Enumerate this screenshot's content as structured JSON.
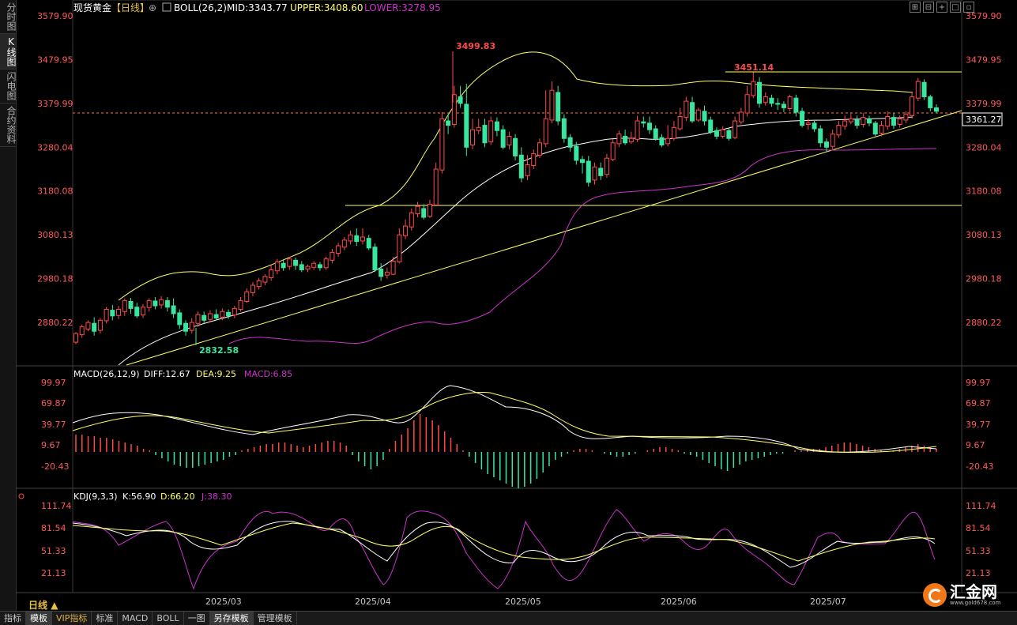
{
  "sidebar": [
    {
      "label": "分时图",
      "active": false
    },
    {
      "label": "K线图",
      "active": true
    },
    {
      "label": "闪电图",
      "active": false
    },
    {
      "label": "合约资料",
      "active": false
    }
  ],
  "header": {
    "symbol": "现货黄金",
    "period_tag": "【日线】",
    "boll_label": "BOLL(26,2)",
    "mid": "MID:3343.77",
    "upper": "UPPER:3408.60",
    "lower": "LOWER:3278.95"
  },
  "toolbar_icons": [
    "expand-icon",
    "shrink-icon",
    "crosshair-icon",
    "fullscreen-icon",
    "pin-icon"
  ],
  "price_panel": {
    "y_ticks": [
      "3579.90",
      "3479.95",
      "3379.99",
      "3280.04",
      "3180.08",
      "3080.13",
      "2980.18",
      "2880.22"
    ],
    "annotations": {
      "high": "3499.83",
      "high2": "3451.14",
      "low": "2832.58",
      "current": "3361.27"
    }
  },
  "macd_panel": {
    "title": "MACD(26,12,9)",
    "diff": "DIFF:12.67",
    "dea": "DEA:9.25",
    "macd": "MACD:6.85",
    "y_ticks": [
      "99.97",
      "69.87",
      "39.77",
      "9.67",
      "-20.43"
    ]
  },
  "kdj_panel": {
    "title": "KDJ(9,3,3)",
    "k": "K:56.90",
    "d": "D:66.20",
    "j": "J:38.30",
    "y_ticks": [
      "111.74",
      "81.54",
      "51.33",
      "21.13"
    ]
  },
  "x_axis": [
    "2025/03",
    "2025/04",
    "2025/05",
    "2025/06",
    "2025/07"
  ],
  "period_label": "日线",
  "bottom_tabs": [
    {
      "label": "指标",
      "sel": false
    },
    {
      "label": "模板",
      "sel": true
    },
    {
      "label": "VIP指标",
      "sel": false,
      "vip": true
    },
    {
      "label": "标准",
      "sel": false
    },
    {
      "label": "MACD",
      "sel": false
    },
    {
      "label": "BOLL",
      "sel": false
    },
    {
      "label": "一图",
      "sel": false
    },
    {
      "label": "另存模板",
      "sel": true
    },
    {
      "label": "管理模板",
      "sel": false
    }
  ],
  "logo": {
    "name": "汇金网",
    "url": "www.gold678.com"
  },
  "colors": {
    "up": "#ff4a4a",
    "down": "#39e6a0",
    "mid": "#ffffff",
    "upper": "#ffff66",
    "lower": "#cc33cc",
    "dea": "#ffff66",
    "diff": "#ffffff",
    "kdj_j": "#cc33cc"
  },
  "chart_data": {
    "type": "candlestick",
    "ylim": [
      2830,
      3590
    ],
    "y_scale_ref": {
      "price_a": 3579.9,
      "price_b": 2880.22
    },
    "candles": [
      [
        2835,
        2855,
        2830,
        2858
      ],
      [
        2852,
        2870,
        2845,
        2875
      ],
      [
        2865,
        2880,
        2860,
        2885
      ],
      [
        2878,
        2860,
        2850,
        2892
      ],
      [
        2862,
        2885,
        2855,
        2890
      ],
      [
        2884,
        2910,
        2878,
        2915
      ],
      [
        2908,
        2895,
        2885,
        2920
      ],
      [
        2896,
        2910,
        2888,
        2918
      ],
      [
        2905,
        2930,
        2895,
        2935
      ],
      [
        2928,
        2912,
        2900,
        2936
      ],
      [
        2915,
        2895,
        2890,
        2925
      ],
      [
        2897,
        2915,
        2890,
        2922
      ],
      [
        2914,
        2930,
        2905,
        2935
      ],
      [
        2929,
        2918,
        2910,
        2938
      ],
      [
        2920,
        2932,
        2912,
        2940
      ],
      [
        2930,
        2915,
        2905,
        2938
      ],
      [
        2918,
        2900,
        2890,
        2935
      ],
      [
        2902,
        2875,
        2865,
        2910
      ],
      [
        2878,
        2860,
        2850,
        2885
      ],
      [
        2862,
        2880,
        2855,
        2890
      ],
      [
        2878,
        2898,
        2870,
        2905
      ],
      [
        2896,
        2885,
        2878,
        2905
      ],
      [
        2887,
        2900,
        2880,
        2908
      ],
      [
        2898,
        2890,
        2885,
        2910
      ],
      [
        2892,
        2905,
        2885,
        2912
      ],
      [
        2903,
        2895,
        2888,
        2910
      ],
      [
        2897,
        2912,
        2890,
        2918
      ],
      [
        2910,
        2930,
        2905,
        2938
      ],
      [
        2928,
        2950,
        2925,
        2958
      ],
      [
        2948,
        2965,
        2940,
        2972
      ],
      [
        2962,
        2975,
        2955,
        2982
      ],
      [
        2972,
        2985,
        2965,
        2990
      ],
      [
        2982,
        3000,
        2975,
        3010
      ],
      [
        2998,
        3018,
        2990,
        3025
      ],
      [
        3015,
        3005,
        2998,
        3025
      ],
      [
        3008,
        3025,
        3000,
        3030
      ],
      [
        3022,
        3010,
        3000,
        3028
      ],
      [
        3012,
        3000,
        2995,
        3020
      ],
      [
        3002,
        3008,
        2995,
        3012
      ],
      [
        3006,
        3015,
        3000,
        3020
      ],
      [
        3012,
        3005,
        2998,
        3018
      ],
      [
        3005,
        3025,
        3000,
        3030
      ],
      [
        3022,
        3040,
        3015,
        3048
      ],
      [
        3038,
        3055,
        3030,
        3062
      ],
      [
        3052,
        3068,
        3045,
        3075
      ],
      [
        3066,
        3080,
        3058,
        3090
      ],
      [
        3078,
        3065,
        3055,
        3095
      ],
      [
        3066,
        3075,
        3058,
        3095
      ],
      [
        3072,
        3050,
        3045,
        3080
      ],
      [
        3052,
        3000,
        2995,
        3060
      ],
      [
        3002,
        2985,
        2975,
        3015
      ],
      [
        2988,
        2995,
        2980,
        3005
      ],
      [
        2990,
        3020,
        2988,
        3030
      ],
      [
        3018,
        3080,
        3015,
        3095
      ],
      [
        3078,
        3100,
        3070,
        3115
      ],
      [
        3098,
        3130,
        3090,
        3140
      ],
      [
        3128,
        3145,
        3120,
        3155
      ],
      [
        3140,
        3120,
        3115,
        3150
      ],
      [
        3122,
        3150,
        3118,
        3160
      ],
      [
        3148,
        3230,
        3145,
        3245
      ],
      [
        3228,
        3345,
        3220,
        3360
      ],
      [
        3340,
        3330,
        3310,
        3355
      ],
      [
        3332,
        3400,
        3325,
        3420
      ],
      [
        3395,
        3380,
        3370,
        3420
      ],
      [
        3378,
        3280,
        3260,
        3425
      ],
      [
        3285,
        3320,
        3275,
        3345
      ],
      [
        3318,
        3325,
        3310,
        3345
      ],
      [
        3330,
        3290,
        3280,
        3345
      ],
      [
        3292,
        3340,
        3285,
        3350
      ],
      [
        3338,
        3318,
        3305,
        3348
      ],
      [
        3320,
        3280,
        3275,
        3330
      ],
      [
        3285,
        3305,
        3275,
        3315
      ],
      [
        3300,
        3260,
        3250,
        3310
      ],
      [
        3262,
        3210,
        3200,
        3280
      ],
      [
        3215,
        3240,
        3205,
        3262
      ],
      [
        3238,
        3265,
        3230,
        3275
      ],
      [
        3262,
        3290,
        3255,
        3300
      ],
      [
        3288,
        3345,
        3280,
        3410
      ],
      [
        3342,
        3410,
        3335,
        3430
      ],
      [
        3405,
        3340,
        3330,
        3420
      ],
      [
        3345,
        3300,
        3290,
        3355
      ],
      [
        3302,
        3280,
        3270,
        3310
      ],
      [
        3282,
        3250,
        3240,
        3292
      ],
      [
        3252,
        3245,
        3220,
        3260
      ],
      [
        3248,
        3200,
        3190,
        3260
      ],
      [
        3205,
        3235,
        3195,
        3245
      ],
      [
        3232,
        3215,
        3205,
        3245
      ],
      [
        3218,
        3255,
        3210,
        3265
      ],
      [
        3252,
        3290,
        3248,
        3298
      ],
      [
        3288,
        3310,
        3280,
        3318
      ],
      [
        3305,
        3290,
        3285,
        3320
      ],
      [
        3292,
        3300,
        3288,
        3315
      ],
      [
        3298,
        3340,
        3292,
        3352
      ],
      [
        3338,
        3335,
        3325,
        3350
      ],
      [
        3335,
        3320,
        3310,
        3350
      ],
      [
        3322,
        3300,
        3295,
        3330
      ],
      [
        3302,
        3285,
        3280,
        3310
      ],
      [
        3288,
        3300,
        3282,
        3330
      ],
      [
        3300,
        3325,
        3295,
        3340
      ],
      [
        3322,
        3350,
        3318,
        3370
      ],
      [
        3348,
        3385,
        3340,
        3395
      ],
      [
        3382,
        3340,
        3335,
        3395
      ],
      [
        3342,
        3365,
        3338,
        3370
      ],
      [
        3362,
        3340,
        3330,
        3375
      ],
      [
        3342,
        3315,
        3310,
        3350
      ],
      [
        3318,
        3305,
        3298,
        3325
      ],
      [
        3305,
        3320,
        3300,
        3328
      ],
      [
        3318,
        3300,
        3295,
        3325
      ],
      [
        3302,
        3340,
        3298,
        3350
      ],
      [
        3338,
        3360,
        3332,
        3370
      ],
      [
        3358,
        3400,
        3350,
        3420
      ],
      [
        3398,
        3430,
        3392,
        3451
      ],
      [
        3428,
        3380,
        3370,
        3440
      ],
      [
        3382,
        3395,
        3375,
        3405
      ],
      [
        3392,
        3380,
        3372,
        3400
      ],
      [
        3380,
        3378,
        3365,
        3392
      ],
      [
        3378,
        3370,
        3360,
        3385
      ],
      [
        3368,
        3395,
        3362,
        3400
      ],
      [
        3392,
        3360,
        3350,
        3400
      ],
      [
        3362,
        3330,
        3325,
        3370
      ],
      [
        3332,
        3335,
        3320,
        3345
      ],
      [
        3335,
        3322,
        3315,
        3342
      ],
      [
        3322,
        3290,
        3280,
        3330
      ],
      [
        3292,
        3280,
        3270,
        3300
      ],
      [
        3282,
        3310,
        3275,
        3320
      ],
      [
        3308,
        3330,
        3302,
        3340
      ],
      [
        3328,
        3340,
        3320,
        3352
      ],
      [
        3338,
        3345,
        3332,
        3358
      ],
      [
        3342,
        3330,
        3322,
        3352
      ],
      [
        3332,
        3348,
        3325,
        3358
      ],
      [
        3345,
        3335,
        3328,
        3352
      ],
      [
        3335,
        3310,
        3305,
        3340
      ],
      [
        3312,
        3330,
        3305,
        3340
      ],
      [
        3328,
        3350,
        3320,
        3362
      ],
      [
        3348,
        3330,
        3322,
        3358
      ],
      [
        3332,
        3345,
        3325,
        3352
      ],
      [
        3342,
        3355,
        3335,
        3362
      ],
      [
        3352,
        3395,
        3345,
        3405
      ],
      [
        3392,
        3430,
        3385,
        3438
      ],
      [
        3428,
        3395,
        3388,
        3435
      ],
      [
        3395,
        3370,
        3362,
        3400
      ],
      [
        3370,
        3362,
        3358,
        3378
      ]
    ]
  }
}
